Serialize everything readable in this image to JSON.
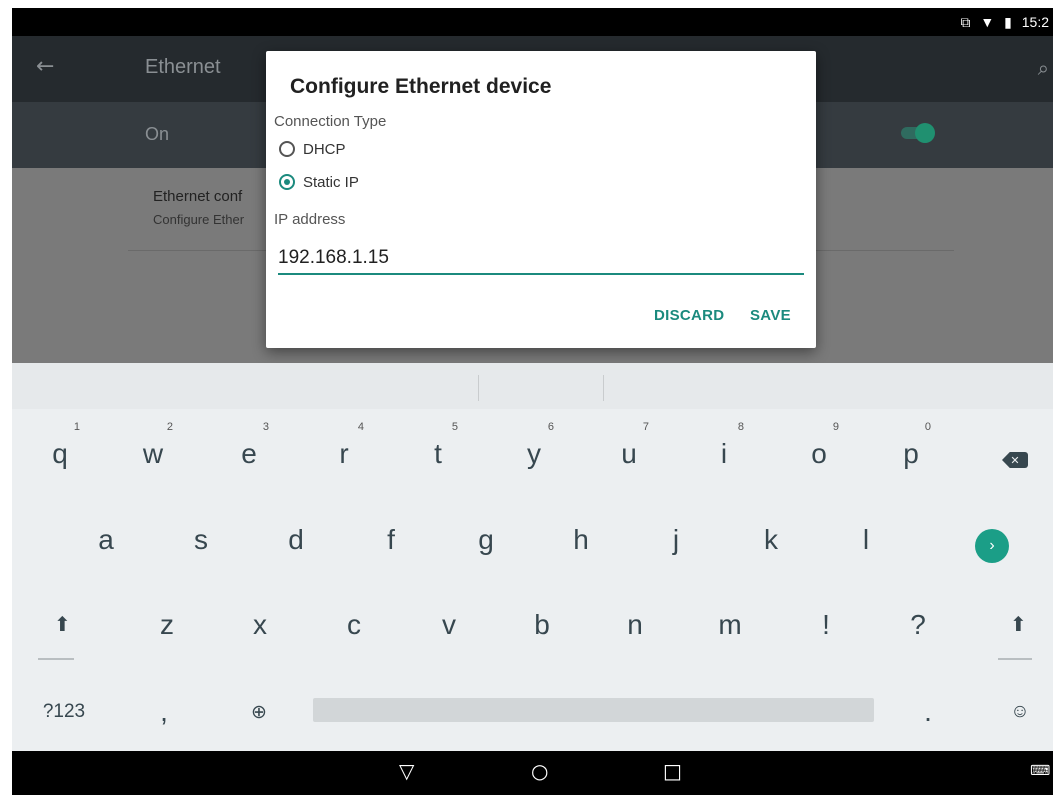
{
  "status_bar": {
    "cast_icon": "cast-icon",
    "wifi_icon": "wifi-icon",
    "battery_icon": "battery-icon",
    "time": "15:2"
  },
  "app_bar": {
    "title": "Ethernet",
    "back_icon": "arrow-left-icon",
    "search_icon": "search-icon"
  },
  "switch_bar": {
    "label": "On",
    "enabled": true
  },
  "content": {
    "item_title": "Ethernet conf",
    "item_subtitle": "Configure Ether"
  },
  "dialog": {
    "title": "Configure Ethernet device",
    "connection_type_label": "Connection Type",
    "options": [
      {
        "label": "DHCP",
        "selected": false
      },
      {
        "label": "Static IP",
        "selected": true
      }
    ],
    "ip_label": "IP address",
    "ip_value": "192.168.1.15",
    "discard_label": "DISCARD",
    "save_label": "SAVE",
    "accent_color": "#1b8a7e"
  },
  "keyboard": {
    "row1": [
      {
        "key": "q",
        "hint": "1"
      },
      {
        "key": "w",
        "hint": "2"
      },
      {
        "key": "e",
        "hint": "3"
      },
      {
        "key": "r",
        "hint": "4"
      },
      {
        "key": "t",
        "hint": "5"
      },
      {
        "key": "y",
        "hint": "6"
      },
      {
        "key": "u",
        "hint": "7"
      },
      {
        "key": "i",
        "hint": "8"
      },
      {
        "key": "o",
        "hint": "9"
      },
      {
        "key": "p",
        "hint": "0"
      }
    ],
    "row2": [
      "a",
      "s",
      "d",
      "f",
      "g",
      "h",
      "j",
      "k",
      "l"
    ],
    "row3": [
      "z",
      "x",
      "c",
      "v",
      "b",
      "n",
      "m",
      "!",
      "?"
    ],
    "symbols_key": "?123",
    "comma_key": ",",
    "period_key": ".",
    "icons": {
      "backspace": "backspace-icon",
      "enter": "enter-arrow-icon",
      "shift": "shift-icon",
      "globe": "globe-icon",
      "emoji": "emoji-icon"
    }
  },
  "nav_bar": {
    "back": "▽",
    "home": "○",
    "recents": "□",
    "keyboard_icon": "keyboard-icon"
  }
}
